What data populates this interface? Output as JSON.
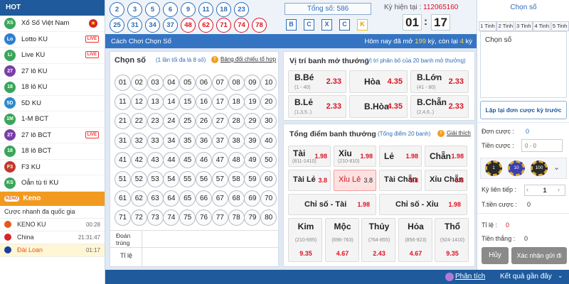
{
  "sidebar": {
    "hot": "HOT",
    "items": [
      {
        "label": "Xổ Số Việt Nam",
        "icon": "vietnam-lottery-icon",
        "badge": "vn-flag"
      },
      {
        "label": "Lotto KU",
        "icon": "lotto-icon",
        "badge": "LIVE"
      },
      {
        "label": "Live KU",
        "icon": "live-ku-icon",
        "badge": "LIVE"
      },
      {
        "label": "27 lô KU",
        "icon": "27-icon"
      },
      {
        "label": "18 lô KU",
        "icon": "18-icon"
      },
      {
        "label": "5D KU",
        "icon": "5d-icon"
      },
      {
        "label": "1-M BCT",
        "icon": "1m-icon"
      },
      {
        "label": "27 lô BCT",
        "icon": "27-bct-icon",
        "badge": "LIVE"
      },
      {
        "label": "18 lô BCT",
        "icon": "18-bct-icon"
      },
      {
        "label": "F3 KU",
        "icon": "f3-icon"
      },
      {
        "label": "Oẳn tù tì KU",
        "icon": "rps-icon"
      }
    ],
    "keno": "Keno",
    "keno_sub": [
      {
        "label": "Cược nhanh đa quốc gia",
        "time": ""
      },
      {
        "label": "KENO KU",
        "time": "00:28",
        "color": "#e05a1a"
      },
      {
        "label": "China",
        "time": "21:31:47",
        "color": "#d8232a"
      },
      {
        "label": "Đài Loan",
        "time": "01:17",
        "color": "#1a3f9c"
      }
    ]
  },
  "top": {
    "balls_row1": [
      "2",
      "3",
      "5",
      "6",
      "9",
      "11",
      "18",
      "23"
    ],
    "balls_row2": [
      "25",
      "31",
      "34",
      "37",
      "48",
      "62",
      "71",
      "74",
      "78"
    ],
    "total": "Tổng số: 586",
    "bcxck": [
      "B",
      "C",
      "X",
      "C",
      "K"
    ],
    "ky_label": "Kỳ hiện tại :",
    "ky_value": "112065160",
    "min": "01",
    "sec": "17"
  },
  "bluebar": {
    "title": "Cách Chơi Chọn Số",
    "info_pre": "Hôm nay đã mở ",
    "opened": "199",
    "info_mid": " kỳ, còn lại ",
    "left": "4",
    "info_post": " kỳ"
  },
  "chon_so": {
    "title": "Chọn số",
    "hint": "(1 lần tối đa là 8 số)",
    "table_link": "Bảng đối chiếu tổ hợp",
    "dat_trung": "Đoán trúng",
    "ti_le": "Tỉ lệ"
  },
  "numbers": [
    "01",
    "02",
    "03",
    "04",
    "05",
    "06",
    "07",
    "08",
    "09",
    "10",
    "11",
    "12",
    "13",
    "14",
    "15",
    "16",
    "17",
    "18",
    "19",
    "20",
    "21",
    "22",
    "23",
    "24",
    "25",
    "26",
    "27",
    "28",
    "29",
    "30",
    "31",
    "32",
    "33",
    "34",
    "35",
    "36",
    "37",
    "38",
    "39",
    "40",
    "41",
    "42",
    "43",
    "44",
    "45",
    "46",
    "47",
    "48",
    "49",
    "50",
    "51",
    "52",
    "53",
    "54",
    "55",
    "56",
    "57",
    "58",
    "59",
    "60",
    "61",
    "62",
    "63",
    "64",
    "65",
    "66",
    "67",
    "68",
    "69",
    "70",
    "71",
    "72",
    "73",
    "74",
    "75",
    "76",
    "77",
    "78",
    "79",
    "80"
  ],
  "vitri": {
    "title": "Vị trí banh mở thưởng",
    "hint": "(Vị trí phân bố của 20 banh mở thưởng)",
    "cells": [
      {
        "label": "B.Bé",
        "range": "(1 - 40)",
        "odd": "2.33"
      },
      {
        "label": "Hòa",
        "range": "",
        "odd": "4.35"
      },
      {
        "label": "B.Lớn",
        "range": "(41 - 80)",
        "odd": "2.33"
      },
      {
        "label": "B.Lẻ",
        "range": "(1,3,5..)",
        "odd": "2.33"
      },
      {
        "label": "B.Hòa",
        "range": "",
        "odd": "4.35"
      },
      {
        "label": "B.Chẵn",
        "range": "(2,4,6..)",
        "odd": "2.33"
      }
    ]
  },
  "tongdiem": {
    "title": "Tổng điểm banh thưởng",
    "hint": "(Tổng điểm 20 banh)",
    "explain": "Giải thích",
    "row1": [
      {
        "label": "Tài",
        "range": "(811-1410)",
        "odd": "1.98"
      },
      {
        "label": "Xỉu",
        "range": "(210-810)",
        "odd": "1.98"
      },
      {
        "label": "Lẻ",
        "range": "",
        "odd": "1.98"
      },
      {
        "label": "Chẵn",
        "range": "",
        "odd": "1.98"
      }
    ],
    "row2": [
      {
        "label": "Tài Lẻ",
        "odd": "3.8"
      },
      {
        "label": "Xỉu Lẻ",
        "odd": "3.8"
      },
      {
        "label": "Tài Chẵn",
        "odd": "3.8"
      },
      {
        "label": "Xỉu Chẵn",
        "odd": "3.8"
      }
    ],
    "row3": [
      {
        "label": "Chỉ số - Tài",
        "odd": "1.98"
      },
      {
        "label": "Chỉ số - Xỉu",
        "odd": "1.98"
      }
    ],
    "row4": [
      {
        "label": "Kim",
        "range": "(210-695)",
        "odd": "9.35"
      },
      {
        "label": "Mộc",
        "range": "(696-763)",
        "odd": "4.67"
      },
      {
        "label": "Thủy",
        "range": "(764-855)",
        "odd": "2.43"
      },
      {
        "label": "Hỏa",
        "range": "(856-923)",
        "odd": "4.67"
      },
      {
        "label": "Thổ",
        "range": "(924-1410)",
        "odd": "9.35"
      }
    ]
  },
  "right": {
    "title": "Chọn số",
    "tabs": [
      "1 Tinh",
      "2 Tinh",
      "3 Tinh",
      "4 Tinh",
      "5 Tinh"
    ],
    "chon_so_label": "Chọn số",
    "reorder": "Lập lại đơn cược kỳ trước",
    "don_cuoc": "Đơn cược :",
    "don_cuoc_val": "0",
    "tien_cuoc": "Tiền cược :",
    "tien_cuoc_ph": "0 - 0",
    "chips": [
      "1",
      "10",
      "100"
    ],
    "ky_lien": "Kỳ liên tiếp :",
    "ky_val": "1",
    "t_tien": "T.tiền cược :",
    "t_tien_val": "0",
    "ti_le": "Tỉ lệ :",
    "ti_le_val": "0",
    "tien_thang": "Tiền thắng :",
    "tien_thang_val": "0",
    "cancel": "Hủy",
    "confirm": "Xác nhận gửi đi"
  },
  "footer": {
    "analysis": "Phân tích",
    "recent": "Kết quả gần đây"
  },
  "colors": {
    "accent": "#1e5a9c",
    "red": "#dd1122",
    "orange": "#f29a1f"
  }
}
